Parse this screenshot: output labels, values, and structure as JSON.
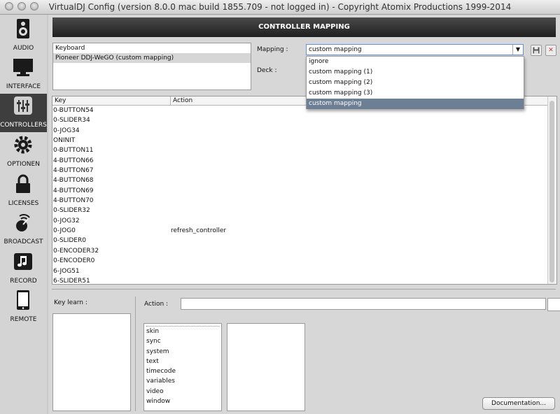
{
  "window": {
    "title": "VirtualDJ Config (version 8.0.0 mac build 1855.709 - not logged in) - Copyright Atomix Productions 1999-2014"
  },
  "sidebar": {
    "items": [
      {
        "label": "AUDIO",
        "icon": "speaker-icon",
        "active": false
      },
      {
        "label": "INTERFACE",
        "icon": "monitor-icon",
        "active": false
      },
      {
        "label": "CONTROLLERS",
        "icon": "sliders-icon",
        "active": true
      },
      {
        "label": "OPTIONEN",
        "icon": "gear-icon",
        "active": false
      },
      {
        "label": "LICENSES",
        "icon": "lock-icon",
        "active": false
      },
      {
        "label": "BROADCAST",
        "icon": "broadcast-icon",
        "active": false
      },
      {
        "label": "RECORD",
        "icon": "music-note-icon",
        "active": false
      },
      {
        "label": "REMOTE",
        "icon": "tablet-icon",
        "active": false
      }
    ]
  },
  "header": {
    "title": "CONTROLLER MAPPING"
  },
  "devices": [
    "Keyboard",
    "Pioneer DDJ-WeGO  (custom mapping)"
  ],
  "mapping": {
    "label": "Mapping :",
    "value": "custom mapping",
    "deck_label": "Deck :",
    "options": [
      "ignore",
      "custom mapping (1)",
      "custom mapping (2)",
      "custom mapping (3)",
      "custom mapping"
    ]
  },
  "grid": {
    "columns": [
      "Key",
      "Action"
    ],
    "rows": [
      {
        "key": "0-BUTTON54",
        "action": ""
      },
      {
        "key": "0-SLIDER34",
        "action": ""
      },
      {
        "key": "0-JOG34",
        "action": ""
      },
      {
        "key": "ONINIT",
        "action": ""
      },
      {
        "key": "0-BUTTON11",
        "action": ""
      },
      {
        "key": "4-BUTTON66",
        "action": ""
      },
      {
        "key": "4-BUTTON67",
        "action": ""
      },
      {
        "key": "4-BUTTON68",
        "action": ""
      },
      {
        "key": "4-BUTTON69",
        "action": ""
      },
      {
        "key": "4-BUTTON70",
        "action": ""
      },
      {
        "key": "0-SLIDER32",
        "action": ""
      },
      {
        "key": "0-JOG32",
        "action": ""
      },
      {
        "key": "0-JOG0",
        "action": "refresh_controller"
      },
      {
        "key": "0-SLIDER0",
        "action": ""
      },
      {
        "key": "0-ENCODER32",
        "action": ""
      },
      {
        "key": "0-ENCODER0",
        "action": ""
      },
      {
        "key": "6-JOG51",
        "action": ""
      },
      {
        "key": "6-SLIDER51",
        "action": ""
      }
    ]
  },
  "bottom": {
    "key_learn_label": "Key learn :",
    "action_label": "Action :",
    "action_value": "",
    "action_list": [
      "skin",
      "sync",
      "system",
      "text",
      "timecode",
      "variables",
      "video",
      "window"
    ],
    "documentation_button": "Documentation..."
  }
}
